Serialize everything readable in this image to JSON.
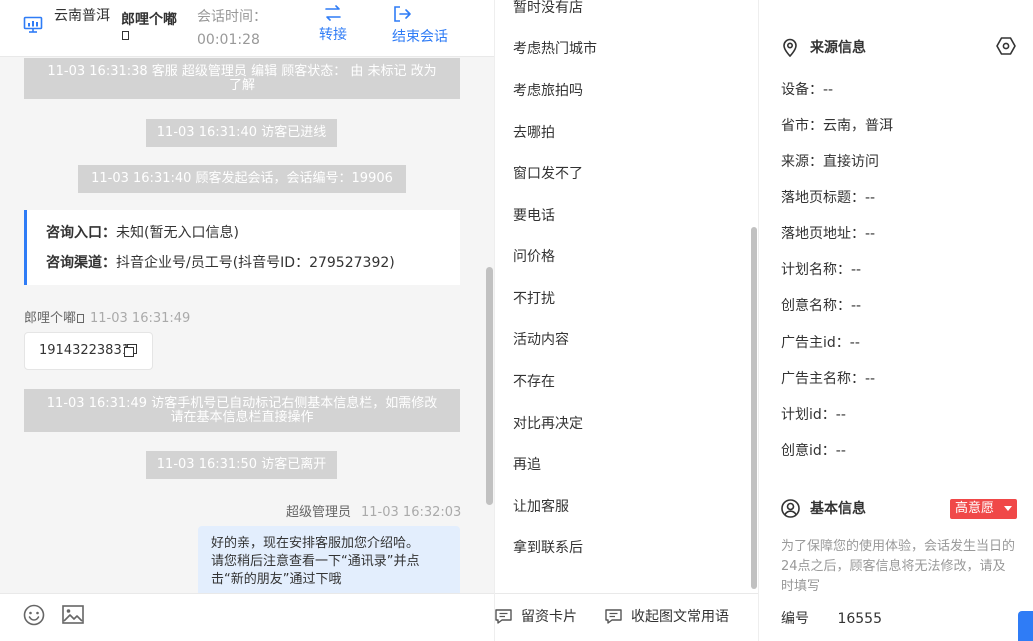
{
  "header": {
    "location": "云南普洱",
    "visitor_name": "郎哩个嘟",
    "session_time_label": "会话时间：",
    "session_time_value": "00:01:28",
    "transfer_label": "转接",
    "end_session_label": "结束会话"
  },
  "chat": {
    "messages": [
      {
        "kind": "system",
        "text": "11-03 16:31:38 客服 超级管理员 编辑 顾客状态： 由 未标记 改为了解"
      },
      {
        "kind": "system",
        "text": "11-03 16:31:40 访客已进线"
      },
      {
        "kind": "system",
        "text": "11-03 16:31:40 顾客发起会话，会话编号：19906"
      },
      {
        "kind": "system",
        "text": "11-03 16:31:49 访客手机号已自动标记右侧基本信息栏，如需修改请在基本信息栏直接操作"
      },
      {
        "kind": "system",
        "text": "11-03 16:31:50 访客已离开"
      }
    ],
    "sys_line1": "11-03 16:31:38 客服 超级管理员 编辑 顾客状态： 由 未标记 改为",
    "sys_line1b": "了解",
    "sys_line4a": "11-03 16:31:49 访客手机号已自动标记右侧基本信息栏，如需修改",
    "sys_line4b": "请在基本信息栏直接操作",
    "entry_card": {
      "entry_label": "咨询入口：",
      "entry_value": "未知(暂无入口信息)",
      "channel_label": "咨询渠道：",
      "channel_value": "抖音企业号/员工号(抖音号ID：279527392)"
    },
    "visitor_msg": {
      "sender": "郎哩个嘟",
      "time": "11-03 16:31:49",
      "text": "19143223831"
    },
    "agent_msg": {
      "sender": "超级管理员",
      "time": "11-03 16:32:03",
      "line1": "好的亲，现在安排客服加您介绍哈。",
      "line2": "请您稍后注意查看一下“通讯录”并点",
      "line3": "击“新的朋友”通过下哦"
    }
  },
  "quick_replies": [
    "暂时没有店",
    "考虑热门城市",
    "考虑旅拍吗",
    "去哪拍",
    "窗口发不了",
    "要电话",
    "问价格",
    "不打扰",
    "活动内容",
    "不存在",
    "对比再决定",
    "再追",
    "让加客服",
    "拿到联系后"
  ],
  "footer": {
    "card_btn": "留资卡片",
    "favorites_btn": "收起图文常用语"
  },
  "source_info": {
    "title": "来源信息",
    "rows": [
      {
        "label": "设备：",
        "value": "--"
      },
      {
        "label": "省市：",
        "value": "云南，普洱"
      },
      {
        "label": "来源：",
        "value": "直接访问"
      },
      {
        "label": "落地页标题：",
        "value": "--"
      },
      {
        "label": "落地页地址：",
        "value": "--"
      },
      {
        "label": "计划名称：",
        "value": "--"
      },
      {
        "label": "创意名称：",
        "value": "--"
      },
      {
        "label": "广告主id：",
        "value": "--"
      },
      {
        "label": "广告主名称：",
        "value": "--"
      },
      {
        "label": "计划id：",
        "value": "--"
      },
      {
        "label": "创意id：",
        "value": "--"
      }
    ]
  },
  "basic_info": {
    "title": "基本信息",
    "badge": "高意愿",
    "note": "为了保障您的使用体验，会话发生当日的24点之后，顾客信息将无法修改，请及时填写",
    "id_label": "编号",
    "id_value": "16555"
  },
  "colors": {
    "accent": "#2f7cf6",
    "badge": "#f04848",
    "system_msg_bg": "#d3d3d3",
    "agent_bubble": "#e3eefd"
  }
}
